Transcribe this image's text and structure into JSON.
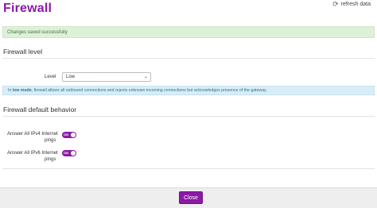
{
  "header": {
    "title": "Firewall",
    "refresh_label": "refresh data",
    "refresh_icon": "refresh-icon"
  },
  "alerts": {
    "success": "Changes saved successfully",
    "info_prefix": "In ",
    "info_mode": "low mode",
    "info_rest": ", firewall allows all outbound connections and rejects unknown incoming connections but acknowledges presence of the gateway."
  },
  "firewall_level": {
    "heading": "Firewall level",
    "level_label": "Level",
    "level_value": "Low"
  },
  "default_behavior": {
    "heading": "Firewall default behavior",
    "ipv4_label_line1": "Answer All IPv4 Internet",
    "ipv4_label_line2": "pings",
    "ipv4_toggle": "ON",
    "ipv6_label_line1": "Answer All IPv6 Internet",
    "ipv6_label_line2": "pings",
    "ipv6_toggle": "ON"
  },
  "footer": {
    "close_label": "Close"
  },
  "colors": {
    "accent": "#8c1aa5",
    "success_bg": "#dff0d8",
    "info_bg": "#d9edf7"
  }
}
